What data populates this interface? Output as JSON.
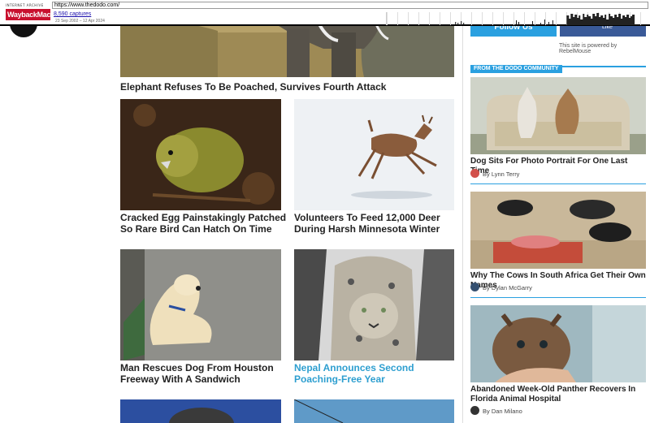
{
  "wayback": {
    "logo_top": "INTERNET ARCHIVE",
    "logo_main": "WaybackMachine",
    "url": "https://www.thedodo.com/",
    "captures": "8,590 captures",
    "range": "23 Sep 2002 – 12 Apr 2024"
  },
  "main": {
    "hero_title": "Elephant Refuses To Be Poached, Survives Fourth Attack",
    "articles": [
      {
        "title": "Cracked Egg Painstakingly Patched So Rare Bird Can Hatch On Time"
      },
      {
        "title": "Volunteers To Feed 12,000 Deer During Harsh Minnesota Winter"
      },
      {
        "title": "Man Rescues Dog From Houston Freeway With A Sandwich"
      },
      {
        "title": "Nepal Announces Second Poaching-Free Year"
      }
    ]
  },
  "sidebar": {
    "follow_label": "Follow Us",
    "like_label": "Like",
    "powered_by": "This site is powered by RebelMouse",
    "community_label": "FROM THE DODO COMMUNITY",
    "posts": [
      {
        "title": "Dog Sits For Photo Portrait For One Last Time",
        "author": "By Lynn Terry"
      },
      {
        "title": "Why The Cows In South Africa Get Their Own Names",
        "author": "By Dylan McGarry"
      },
      {
        "title": "Abandoned Week-Old Panther Recovers In Florida Animal Hospital",
        "author": "By Dan Milano"
      }
    ]
  },
  "colors": {
    "accent": "#2aa0e0",
    "link": "#2e9fd0",
    "facebook": "#3a5a98"
  }
}
